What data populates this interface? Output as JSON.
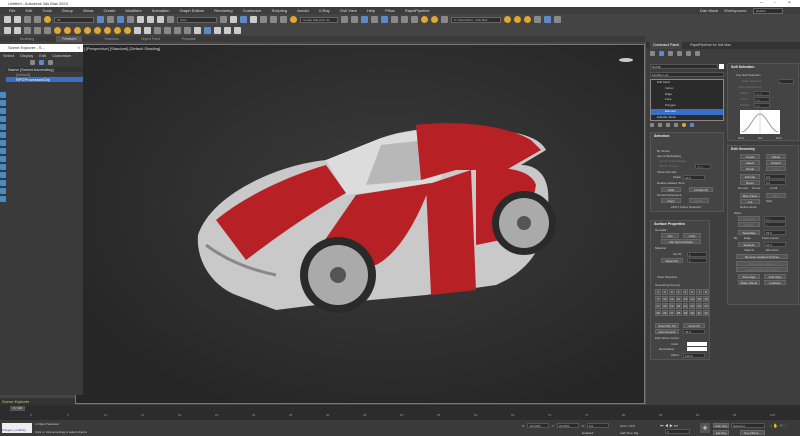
{
  "app": {
    "title": "Untitled - Autodesk 3ds Max 2024",
    "user": "Dan Mock",
    "workspace_label": "Workspaces:",
    "workspace": "Default"
  },
  "menu": [
    "File",
    "Edit",
    "Tools",
    "Group",
    "Views",
    "Create",
    "Modifiers",
    "Animation",
    "Graph Editors",
    "Rendering",
    "Customize",
    "Scripting",
    "Arnold",
    "V-Ray",
    "Civil View",
    "Help",
    "Pflow",
    "RapidPipeline"
  ],
  "toolbar": {
    "selection_filter": "All",
    "ref_coord": "View",
    "named_selection": "Create Selection Se",
    "scene_states": "C:\\Users\\Dan\\...\\3ds Max"
  },
  "ribbon": {
    "tabs": [
      "Modeling",
      "Freeform",
      "Selection",
      "Object Paint",
      "Populate"
    ],
    "active": 1
  },
  "viewport": {
    "label": "[+] [Perspective] [Standard] [Default Shading]",
    "accent": "#c0202a"
  },
  "scene_explorer": {
    "title": "Scene Explorer - S...",
    "menu": [
      "Select",
      "Display",
      "Edit",
      "Customize"
    ],
    "column": "Name (Sorted Ascending)",
    "rows": [
      {
        "name": "[default]",
        "selected": false
      },
      {
        "name": "RPDProcessedObj",
        "selected": true
      }
    ],
    "footer": "Scene Explorer"
  },
  "command_panel": {
    "tabs": [
      "Command Panel",
      "RapidPipeline for 3ds Max"
    ],
    "object_name": "NONE",
    "modifier_list": "Modifier List",
    "stack": [
      {
        "name": "Edit Mesh",
        "level": 0
      },
      {
        "name": "Vertex",
        "level": 1
      },
      {
        "name": "Edge",
        "level": 1
      },
      {
        "name": "Face",
        "level": 1
      },
      {
        "name": "Polygon",
        "level": 1
      },
      {
        "name": "Element",
        "level": 1,
        "selected": true
      },
      {
        "name": "Editable Mesh",
        "level": 0
      }
    ],
    "selection": {
      "title": "Selection",
      "by_vertex": "By Vertex",
      "ignore_backfacing": "Ignore Backfacing",
      "ignore_visible_edges": "Ignore Visible Edges",
      "planar_thresh": "Planar Thresh:",
      "planar_val": "45.0",
      "show_normals": "Show Normals",
      "scale_label": "Scale:",
      "scale_val": "20.0",
      "delete_isolated": "Delete Isolated Verts",
      "hide": "Hide",
      "unhide_all": "Unhide All",
      "named_sel": "Named Selections:",
      "copy": "Copy",
      "paste": "Paste",
      "status": "24071 Faces Selected"
    },
    "surface": {
      "title": "Surface Properties",
      "normals": "Normals:",
      "flip": "Flip",
      "unify": "Unify",
      "flip_mode": "Flip Normal Mode",
      "material": "Material:",
      "set_id": "Set ID:",
      "set_id_val": "1",
      "select_id": "Select ID:",
      "select_id_val": "1",
      "clear_sel": "Clear Selection",
      "smoothing": "Smoothing Groups:",
      "groups": [
        "1",
        "2",
        "3",
        "4",
        "5",
        "6",
        "7",
        "8",
        "9",
        "10",
        "11",
        "12",
        "13",
        "14",
        "15",
        "16",
        "17",
        "18",
        "19",
        "20",
        "21",
        "22",
        "23",
        "24",
        "25",
        "26",
        "27",
        "28",
        "29",
        "30",
        "31",
        "32"
      ],
      "select_by_sg": "Select By SG",
      "clear_all": "Clear All",
      "auto_smooth": "Auto Smooth",
      "auto_val": "45.0",
      "edit_colors": "Edit Vertex Colors",
      "color": "Color:",
      "illum": "Illumination:",
      "alpha": "Alpha:",
      "alpha_val": "100.0"
    },
    "soft": {
      "title": "Soft Selection",
      "use": "Use Soft Selection",
      "edge_dist": "Edge Distance:",
      "edge_val": "1",
      "affect_back": "Affect Backfacing",
      "falloff": "Falloff:",
      "falloff_val": "20.0",
      "pinch": "Pinch:",
      "pinch_val": "0.0",
      "bubble": "Bubble:",
      "bubble_val": "0.0",
      "axis": [
        "20.0",
        "0.0",
        "20.0"
      ]
    },
    "geometry": {
      "title": "Edit Geometry",
      "create": "Create",
      "delete": "Delete",
      "attach": "Attach",
      "detach": "Detach",
      "divide": "Divide",
      "turn": "Turn",
      "extrude": "Extrude",
      "extrude_val": "0.0",
      "bevel": "Bevel",
      "bevel_val": "0.0",
      "normal": "Normal:",
      "group": "Group",
      "local": "Local",
      "slice_plane": "Slice Plane",
      "slice": "Slice",
      "cut": "Cut",
      "split": "Split",
      "refine": "Refine Ends",
      "weld": "Weld",
      "selected": "Selected",
      "sel_val": "0.1",
      "target": "Target",
      "target_val": "4",
      "tessellate": "Tessellate",
      "tess_val": "25.0",
      "by": "By:",
      "edge": "Edge",
      "face_center": "Face-Center",
      "explode": "Explode",
      "explode_val": "24.0",
      "objects": "Objects",
      "elements": "Elements",
      "remove_isolated": "Remove Isolated Vertices",
      "select_open": "Select Open Edges",
      "create_shape": "Create Shape from Edges",
      "view_align": "View Align",
      "grid_align": "Grid Align",
      "make_planar": "Make Planar",
      "collapse": "Collapse"
    }
  },
  "timeline": {
    "frame": "0 / 100",
    "ticks": [
      "0",
      "5",
      "10",
      "15",
      "20",
      "25",
      "30",
      "35",
      "40",
      "45",
      "50",
      "55",
      "60",
      "65",
      "70",
      "75",
      "80",
      "85",
      "90",
      "95",
      "100"
    ]
  },
  "status": {
    "script": "Polygon_LowPoly",
    "selected": "1 Object Selected",
    "prompt": "Click or click-and-drag to select objects",
    "x": "X:",
    "x_val": "-23.6451",
    "y": "Y:",
    "y_val": "29.8511",
    "z": "Z:",
    "z_val": "0.0",
    "grid": "Grid = 10.0",
    "enabled": "Enabled:",
    "add_time_tag": "Add Time Tag",
    "auto_key": "Auto Key",
    "set_key": "Set Key",
    "key_mode": "Selected",
    "key_filters": "Key Filters...",
    "frame_field": "0"
  }
}
